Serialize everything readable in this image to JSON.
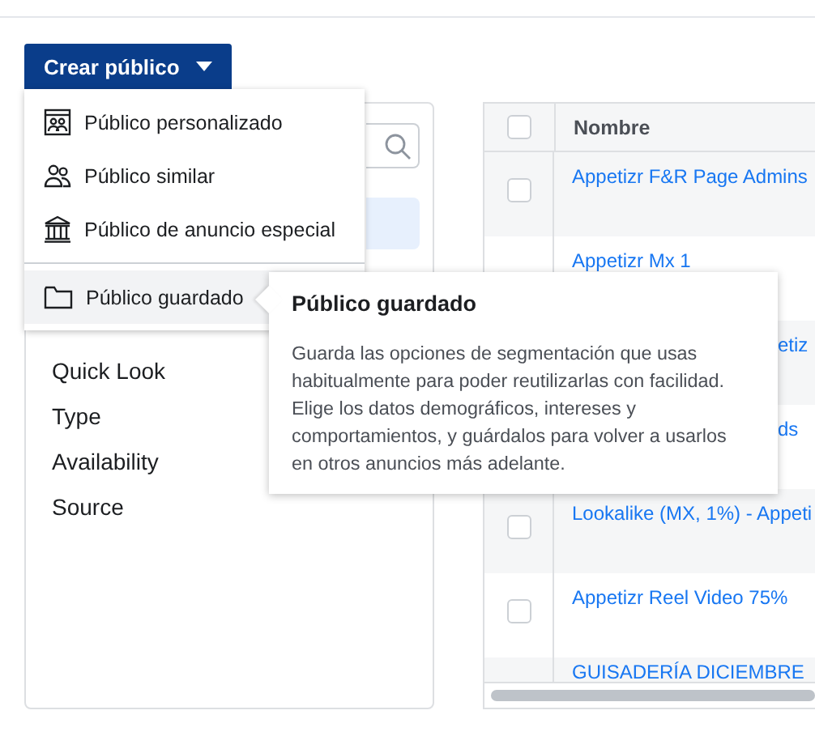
{
  "create_button": {
    "label": "Crear público",
    "expanded": true
  },
  "menu": {
    "groups": [
      [
        {
          "kind": "custom",
          "label": "Público personalizado",
          "selected": false
        },
        {
          "kind": "similar",
          "label": "Público similar",
          "selected": false
        },
        {
          "kind": "special",
          "label": "Público de anuncio especial",
          "selected": false
        }
      ],
      [
        {
          "kind": "saved",
          "label": "Público guardado",
          "selected": true
        }
      ]
    ]
  },
  "tooltip": {
    "title": "Público guardado",
    "body": "Guarda las opciones de segmentación que usas habitualmente para poder reutilizarlas con facilidad. Elige los datos demográficos, intereses y comportamientos, y guárdalos para volver a usarlos en otros anuncios más adelante."
  },
  "sidebar": {
    "items": [
      {
        "label": "Quick Look",
        "selected": false
      },
      {
        "label": "Type",
        "selected": false
      },
      {
        "label": "Availability",
        "selected": false
      },
      {
        "label": "Source",
        "selected": false
      }
    ]
  },
  "table": {
    "columns": [
      "Nombre"
    ],
    "all_checked": false,
    "rows": [
      {
        "name": "Appetizr F&R Page Admins",
        "checked": false,
        "covered": false
      },
      {
        "name": "Appetizr Mx 1",
        "covered": false
      },
      {
        "name": "etiz",
        "covered": true
      },
      {
        "name": "ds",
        "covered": true
      },
      {
        "name": "Lookalike (MX, 1%) - Appeti",
        "checked": false,
        "covered": false
      },
      {
        "name": "Appetizr Reel Video 75%",
        "checked": false,
        "covered": false
      },
      {
        "name": "GUISADERÍA DICIEMBRE",
        "covered": false
      }
    ]
  }
}
